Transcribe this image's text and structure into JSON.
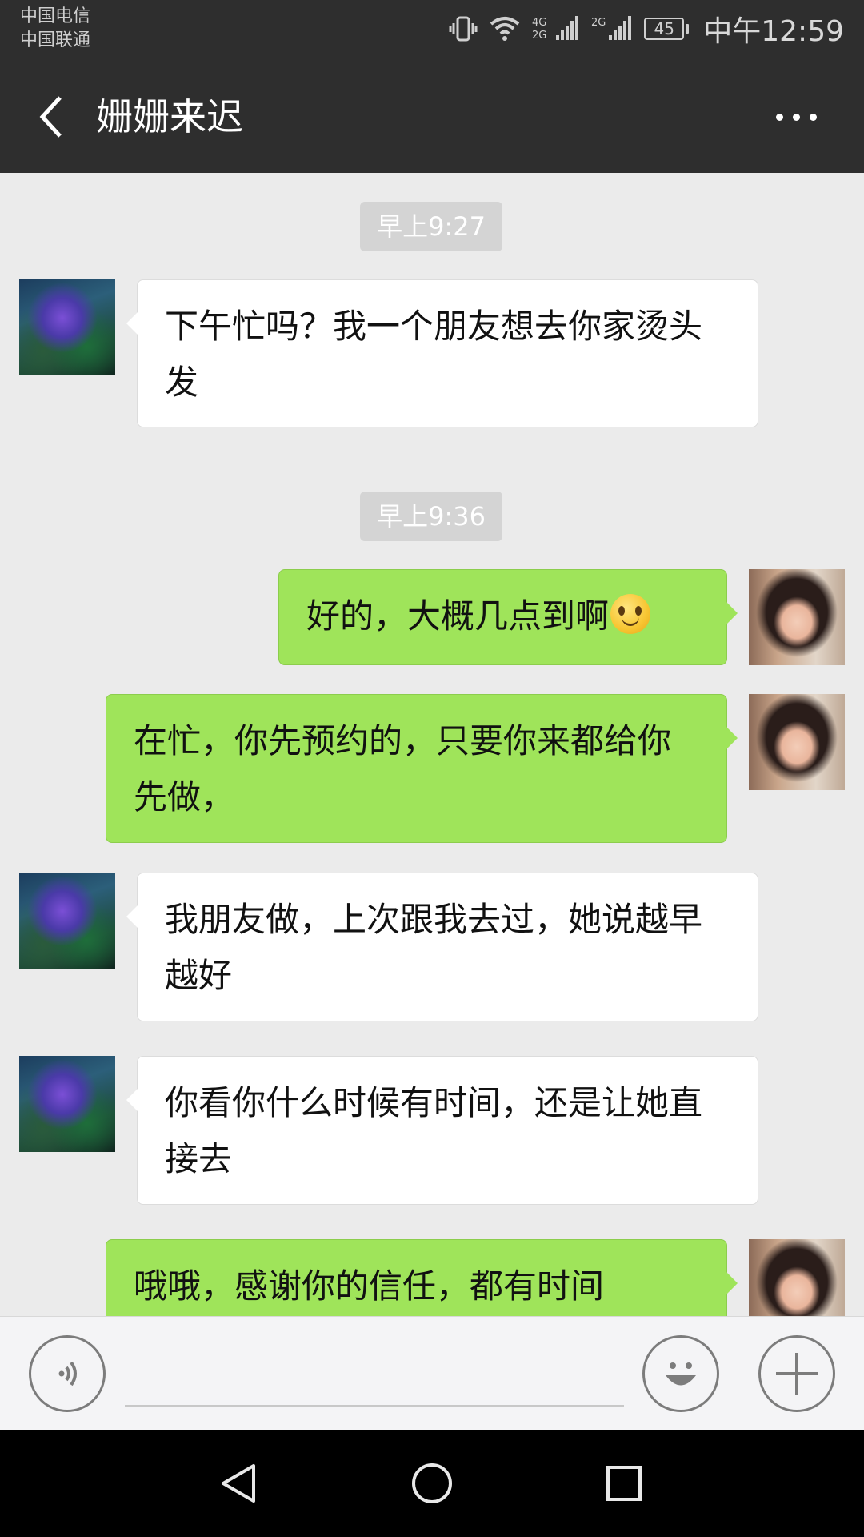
{
  "status_bar": {
    "carrier_1": "中国电信",
    "carrier_2": "中国联通",
    "network_1": "4G",
    "network_1b": "2G",
    "network_2": "2G",
    "battery": "45",
    "time": "中午12:59",
    "icons": [
      "vibrate-icon",
      "wifi-icon",
      "signal-icon",
      "signal-icon",
      "battery-icon"
    ]
  },
  "header": {
    "title": "姗姗来迟",
    "back_icon": "back-arrow-icon",
    "more_icon": "more-dots-icon"
  },
  "messages": [
    {
      "type": "timestamp",
      "text": "早上9:27"
    },
    {
      "type": "message",
      "side": "left",
      "avatar": "fish-avatar",
      "text": "下午忙吗？我一个朋友想去你家烫头发"
    },
    {
      "type": "timestamp",
      "text": "早上9:36"
    },
    {
      "type": "message",
      "side": "right",
      "avatar": "user-avatar",
      "text": "好的，大概几点到啊",
      "emoji": "smile-emoji-icon"
    },
    {
      "type": "message",
      "side": "right",
      "avatar": "user-avatar",
      "text": "在忙，你先预约的，只要你来都给你先做，"
    },
    {
      "type": "message",
      "side": "left",
      "avatar": "fish-avatar",
      "text": "我朋友做，上次跟我去过，她说越早越好"
    },
    {
      "type": "message",
      "side": "left",
      "avatar": "fish-avatar",
      "text": "你看你什么时候有时间，还是让她直接去"
    },
    {
      "type": "message",
      "side": "right",
      "avatar": "user-avatar",
      "text": "哦哦，感谢你的信任，都有时间"
    }
  ],
  "input_bar": {
    "voice_icon": "voice-icon",
    "emoji_icon": "emoji-icon",
    "add_icon": "plus-icon",
    "input_value": ""
  },
  "nav_bar": {
    "icons": [
      "nav-back-icon",
      "nav-home-icon",
      "nav-recents-icon"
    ]
  },
  "colors": {
    "bar_bg": "#2e2e2e",
    "chat_bg": "#ebebeb",
    "bubble_right": "#9fe45a",
    "bubble_left": "#ffffff",
    "timestamp_bg": "#d4d4d4"
  }
}
